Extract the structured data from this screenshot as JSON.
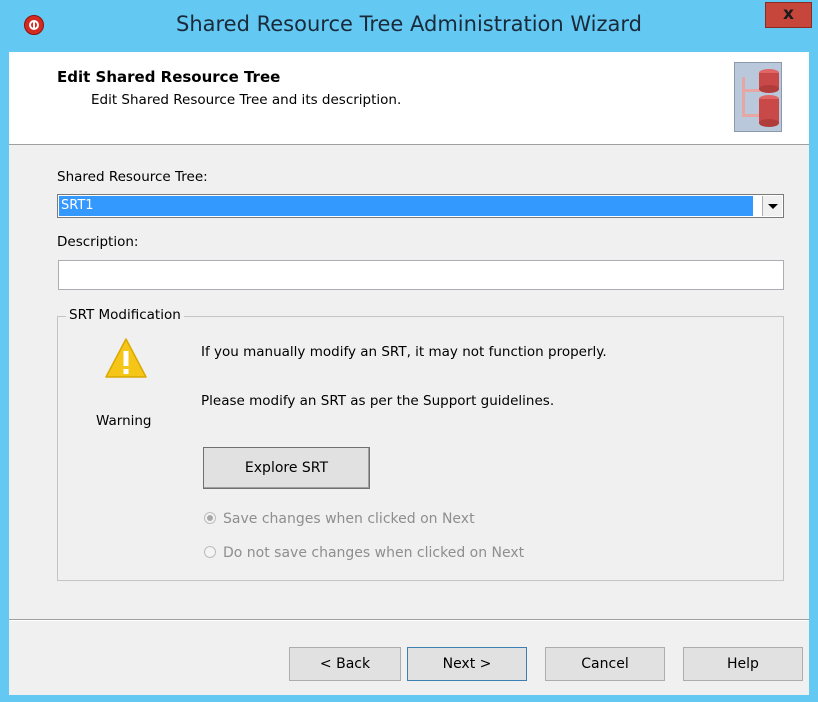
{
  "window": {
    "title": "Shared Resource Tree Administration Wizard",
    "close_glyph": "x",
    "app_icon": "app-logo-icon"
  },
  "header": {
    "title": "Edit Shared Resource Tree",
    "subtitle": "Edit Shared Resource Tree and its description.",
    "graphic": "srt-wizard-icon"
  },
  "form": {
    "srt_label": "Shared Resource Tree:",
    "srt_selected": "SRT1",
    "description_label": "Description:",
    "description_value": ""
  },
  "srt_modification": {
    "group_title": "SRT Modification",
    "warning_label": "Warning",
    "warning_icon": "warning-triangle-icon",
    "message1": "If you manually modify an SRT, it may not function properly.",
    "message2": "Please modify an SRT as per the Support guidelines.",
    "explore_button": "Explore SRT",
    "options": [
      {
        "label": "Save changes when clicked on Next",
        "selected": true,
        "enabled": false
      },
      {
        "label": "Do not save changes when clicked on Next",
        "selected": false,
        "enabled": false
      }
    ]
  },
  "footer": {
    "back": "< Back",
    "next": "Next >",
    "cancel": "Cancel",
    "help": "Help"
  },
  "colors": {
    "titlebar": "#63c8f2",
    "selection": "#3399ff",
    "warning": "#f5c518",
    "close_button": "#c7463b"
  }
}
